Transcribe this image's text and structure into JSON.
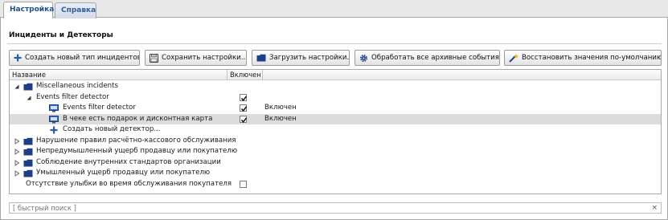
{
  "tabs": [
    {
      "label": "Настройка",
      "active": true
    },
    {
      "label": "Справка",
      "active": false
    }
  ],
  "section": {
    "title": "Инциденты и Детекторы"
  },
  "toolbar": {
    "create_type": "Создать новый тип инцидентов",
    "save_settings": "Сохранить настройки...",
    "load_settings": "Загрузить настройки...",
    "process_archive": "Обработать все архивные события...",
    "restore_defaults": "Восстановить значения по-умолчанию"
  },
  "grid": {
    "columns": {
      "name": "Название",
      "enabled": "Включен"
    },
    "rows": {
      "r0": {
        "label": "Miscellaneous incidents"
      },
      "r1": {
        "label": "Events filter detector",
        "checked": true
      },
      "r2": {
        "label": "Events filter detector",
        "checked": true,
        "status": "Включен"
      },
      "r3": {
        "label": "В чеке есть подарок и дисконтная карта",
        "checked": true,
        "status": "Включен"
      },
      "r4": {
        "label": "Создать новый детектор..."
      },
      "r5": {
        "label": "Нарушение правил расчётно-кассового обслуживания"
      },
      "r6": {
        "label": "Непредумышленный ущерб продавцу или покупателю"
      },
      "r7": {
        "label": "Соблюдение внутренних стандартов организации"
      },
      "r8": {
        "label": "Умышленный ущерб продавцу или покупателю"
      },
      "r9": {
        "label": "Отсутствие улыбки во время обслуживания покупателя",
        "checked": false
      }
    }
  },
  "search": {
    "placeholder": "[ быстрый поиск ]",
    "clear": "×"
  },
  "colors": {
    "accent": "#1f4f8e",
    "folder": "#1d3f86",
    "selected_row": "#dcdcdc"
  }
}
